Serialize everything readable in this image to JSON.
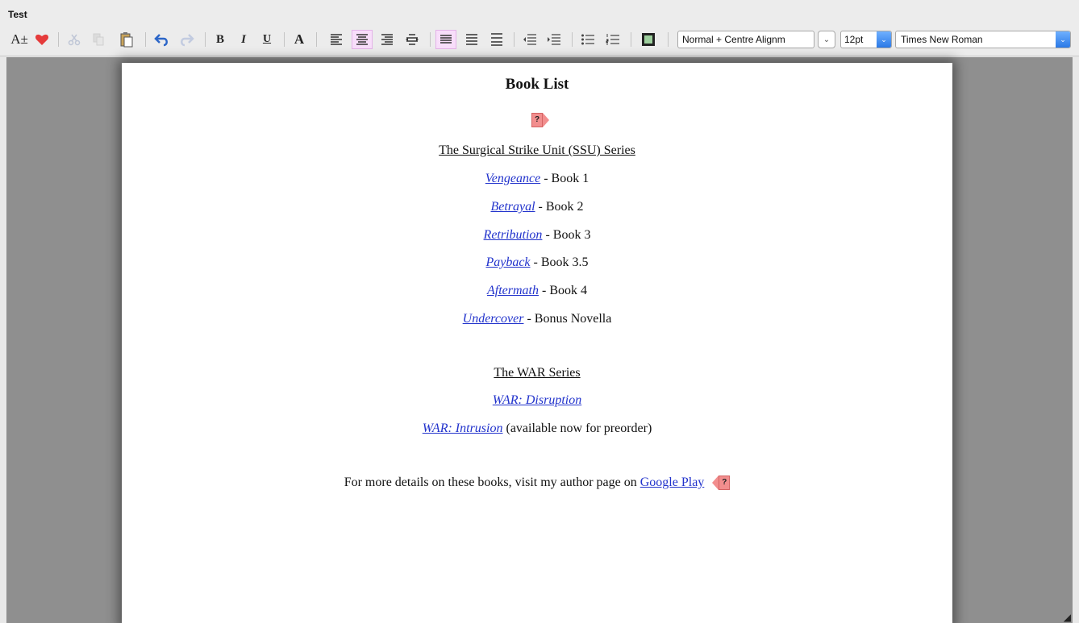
{
  "window": {
    "title": "Test"
  },
  "toolbar": {
    "icons": [
      "font-size-icon",
      "heart-icon",
      "cut-icon",
      "copy-icon",
      "paste-icon",
      "undo-icon",
      "redo-icon",
      "bold-icon",
      "italic-icon",
      "underline-icon",
      "text-color-icon",
      "align-left-icon",
      "align-center-icon",
      "align-right-icon",
      "align-justify-icon",
      "line-spacing-1-icon",
      "line-spacing-2-icon",
      "line-spacing-3-icon",
      "indent-decrease-icon",
      "indent-increase-icon",
      "bullet-list-icon",
      "numbered-list-icon",
      "insert-image-icon"
    ],
    "style_value": "Normal + Centre Alignm",
    "font_size_value": "12pt",
    "font_family_value": "Times New Roman",
    "labels": {
      "bold": "B",
      "italic": "I",
      "underline": "U",
      "text_color": "A",
      "font_size": "A±",
      "marker": "?"
    }
  },
  "document": {
    "title": "Book List",
    "series1_heading": "The Surgical Strike Unit (SSU) Series",
    "books1": [
      {
        "title": "Vengeance",
        "suffix": " - Book 1"
      },
      {
        "title": "Betrayal",
        "suffix": " - Book 2"
      },
      {
        "title": "Retribution",
        "suffix": " - Book 3"
      },
      {
        "title": "Payback",
        "suffix": " - Book 3.5"
      },
      {
        "title": "Aftermath",
        "suffix": " - Book 4"
      },
      {
        "title": "Undercover",
        "suffix": " - Bonus Novella"
      }
    ],
    "series2_heading": "The WAR Series",
    "books2": [
      {
        "title": "WAR: Disruption",
        "suffix": ""
      },
      {
        "title": "WAR: Intrusion",
        "suffix": " (available now for preorder)"
      }
    ],
    "footer_text": "For more details on these books, visit my author page on ",
    "footer_link": "Google Play"
  },
  "colors": {
    "link": "#2233cc",
    "marker": "#f28e8e",
    "active_button": "#f8defa",
    "dropdown_accent": "#2b79e6"
  }
}
